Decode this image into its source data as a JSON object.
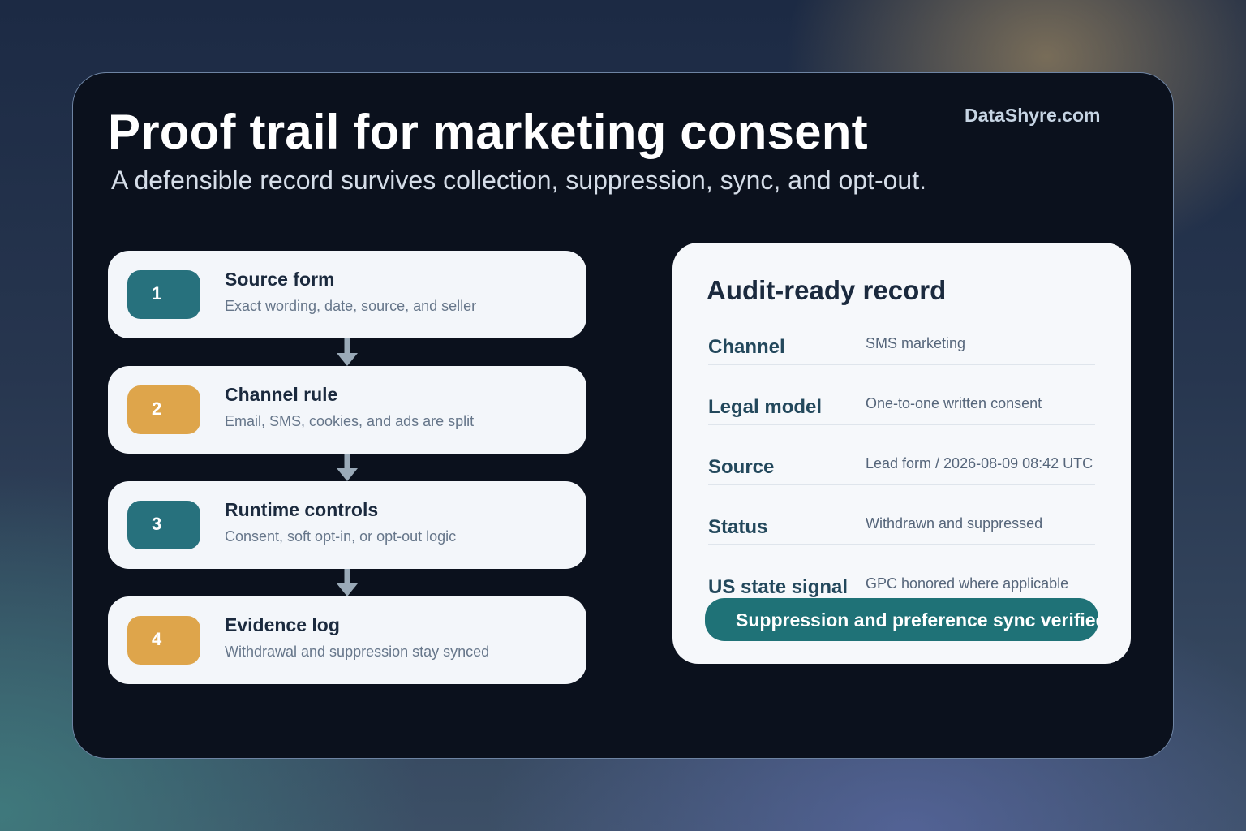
{
  "header": {
    "title": "Proof trail for marketing consent",
    "brand": "DataShyre.com",
    "subtitle": "A defensible record survives collection, suppression, sync, and opt-out."
  },
  "steps": [
    {
      "number": "1",
      "title": "Source form",
      "description": "Exact wording, date, source, and seller",
      "accent": "#27717d"
    },
    {
      "number": "2",
      "title": "Channel rule",
      "description": "Email, SMS, cookies, and ads are split",
      "accent": "#dea54b"
    },
    {
      "number": "3",
      "title": "Runtime controls",
      "description": "Consent, soft opt-in, or opt-out logic",
      "accent": "#27717d"
    },
    {
      "number": "4",
      "title": "Evidence log",
      "description": "Withdrawal and suppression stay synced",
      "accent": "#dea54b"
    }
  ],
  "record": {
    "title": "Audit-ready record",
    "rows": [
      {
        "label": "Channel",
        "value": "SMS marketing"
      },
      {
        "label": "Legal model",
        "value": "One-to-one written consent"
      },
      {
        "label": "Source",
        "value": "Lead form / 2026-08-09 08:42 UTC"
      },
      {
        "label": "Status",
        "value": "Withdrawn and suppressed"
      },
      {
        "label": "US state signal",
        "value": "GPC honored where applicable"
      }
    ],
    "verification": "Suppression and preference sync verified"
  },
  "colors": {
    "teal": "#27717d",
    "amber": "#dea54b",
    "verify_bar": "#1f7277",
    "arrow": "#9aaab8"
  }
}
